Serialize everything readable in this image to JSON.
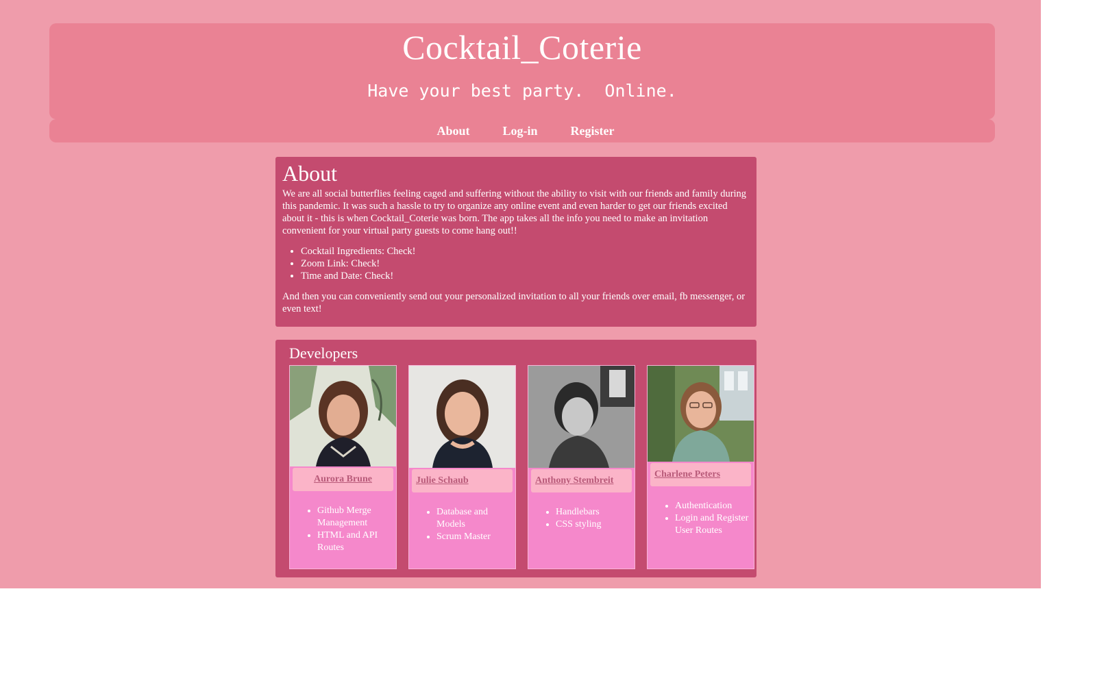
{
  "header": {
    "title": "Cocktail_Coterie",
    "tagline": "Have your best party.  Online."
  },
  "nav": [
    {
      "label": "About"
    },
    {
      "label": "Log-in"
    },
    {
      "label": "Register"
    }
  ],
  "about": {
    "title": "About",
    "intro": "We are all social butterflies feeling caged and suffering without the ability to visit with our friends and family during this pandemic. It was such a hassle to try to organize any online event and even harder to get our friends excited about it - this is when Cocktail_Coterie was born. The app takes all the info you need to make an invitation convenient for your virtual party guests to come hang out!!",
    "checklist": [
      "Cocktail Ingredients: Check!",
      "Zoom Link: Check!",
      "Time and Date: Check!"
    ],
    "closing": "And then you can conveniently send out your personalized invitation to all your friends over email, fb messenger, or even text!"
  },
  "developers": {
    "title": "Developers",
    "people": [
      {
        "name": "Aurora Brune",
        "tasks": [
          "Github Merge Management",
          "HTML and API Routes"
        ]
      },
      {
        "name": "Julie Schaub",
        "tasks": [
          "Database and Models",
          "Scrum Master"
        ]
      },
      {
        "name": "Anthony Stembreit",
        "tasks": [
          "Handlebars",
          "CSS styling"
        ]
      },
      {
        "name": "Charlene Peters",
        "tasks": [
          "Authentication",
          "Login and Register User Routes"
        ]
      }
    ]
  },
  "colors": {
    "page_bg": "#ef9cab",
    "header_bg": "#ea8294",
    "panel_bg": "#c44b6f",
    "card_bg": "#f588cb",
    "name_button_bg": "#fbb4c8"
  }
}
